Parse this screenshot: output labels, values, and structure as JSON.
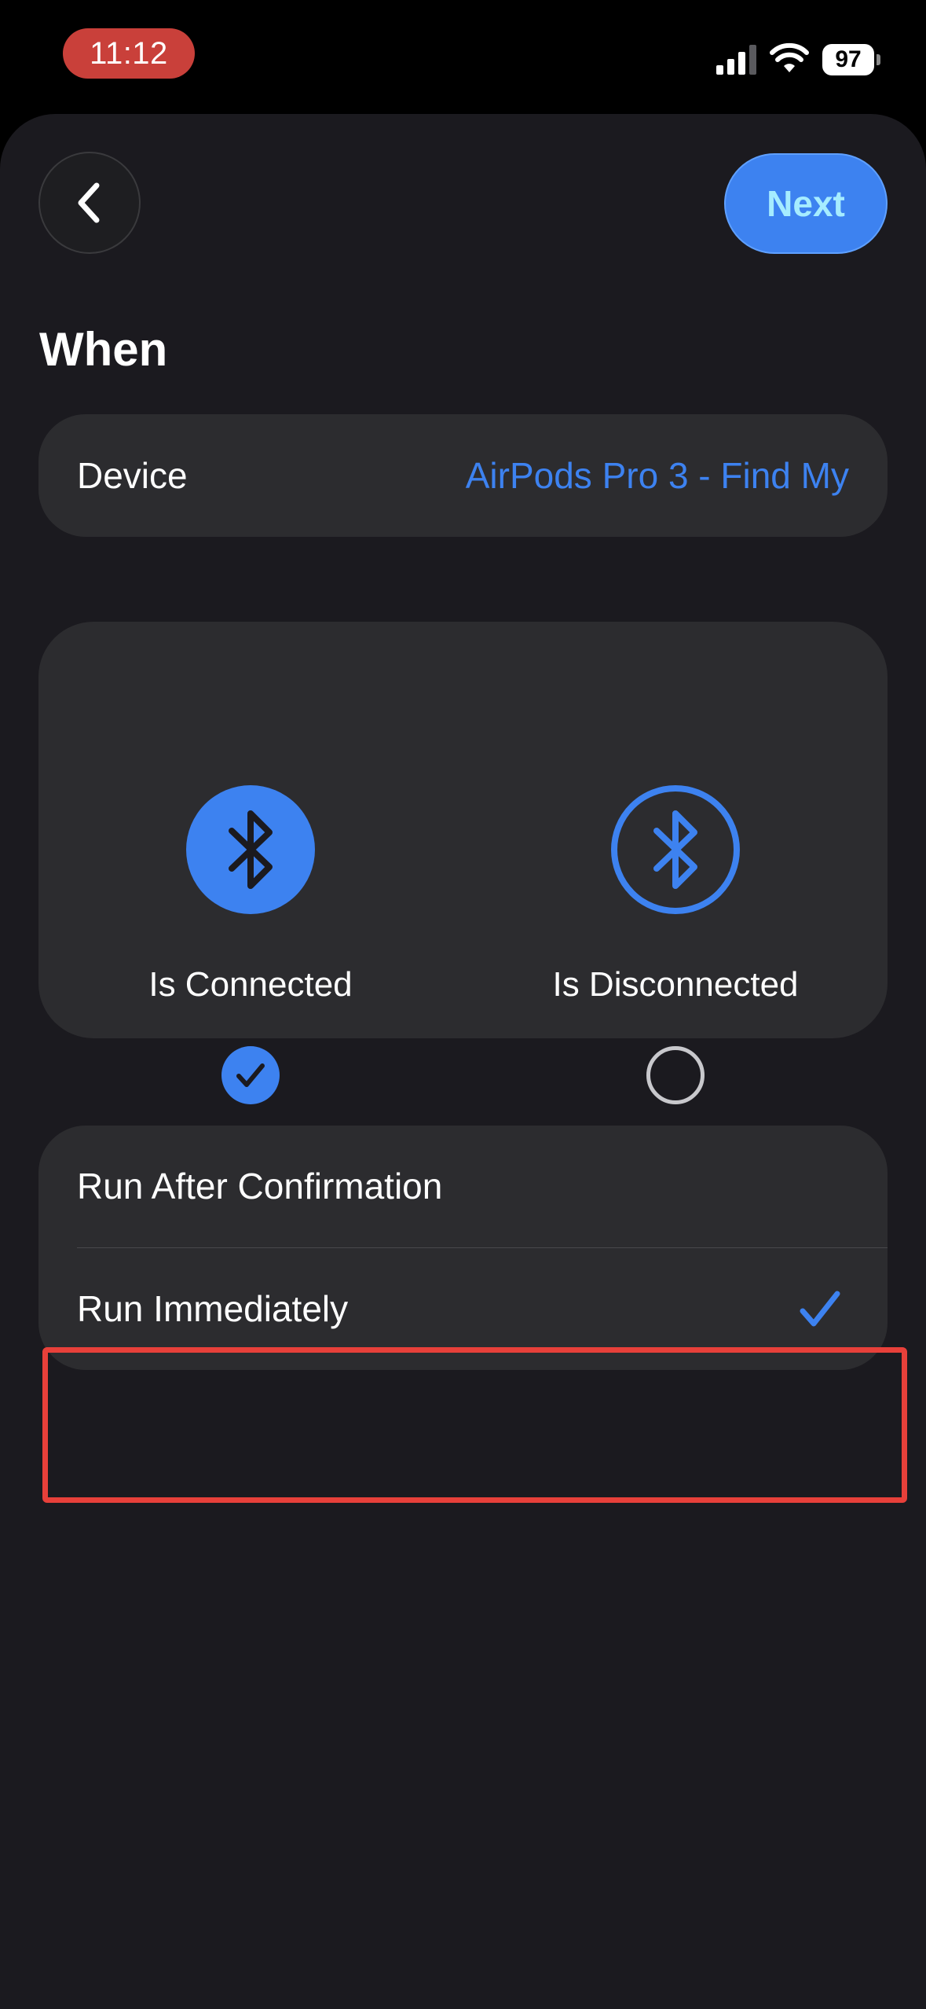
{
  "status_bar": {
    "time": "11:12",
    "battery_level": "97",
    "signal_icon": "cellular-signal-icon",
    "wifi_icon": "wifi-icon"
  },
  "nav": {
    "back_icon": "chevron-left-icon",
    "next_label": "Next"
  },
  "section_title": "When",
  "device": {
    "label": "Device",
    "value": "AirPods Pro 3 - Find My"
  },
  "states": [
    {
      "label": "Is Connected",
      "icon": "bluetooth-icon",
      "selected": true
    },
    {
      "label": "Is Disconnected",
      "icon": "bluetooth-icon",
      "selected": false
    }
  ],
  "run_options": [
    {
      "label": "Run After Confirmation",
      "selected": false
    },
    {
      "label": "Run Immediately",
      "selected": true
    }
  ],
  "colors": {
    "accent": "#3d82f0",
    "background": "#1b1a1f",
    "card": "#2c2c2f",
    "highlight": "#e8403a",
    "time_pill": "#c9403a"
  }
}
